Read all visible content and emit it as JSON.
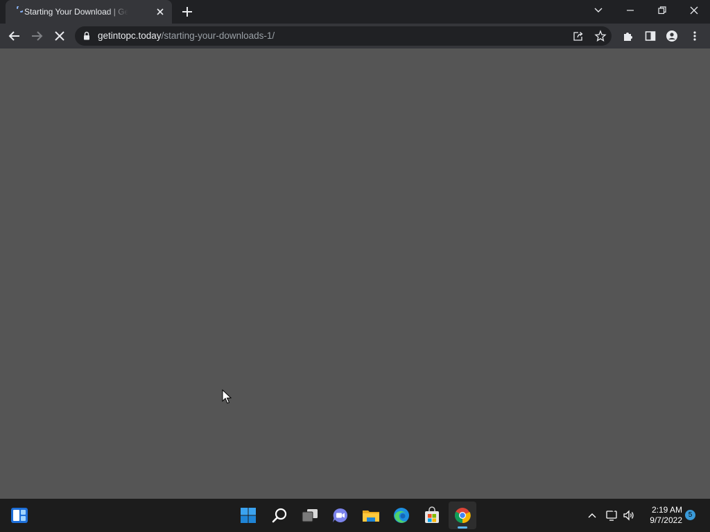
{
  "browser": {
    "tab": {
      "title": "Starting Your Download | Get Into PC",
      "close_icon": "close-icon",
      "loading_icon": "spinner-icon"
    },
    "new_tab_icon": "plus-icon",
    "window_controls": [
      "chevron-down-icon",
      "minimize-icon",
      "restore-icon",
      "close-icon"
    ],
    "address": {
      "host": "getintopc.today",
      "path": "/starting-your-downloads-1/"
    },
    "nav_icons": [
      "back-arrow-icon",
      "forward-arrow-icon",
      "stop-icon"
    ],
    "toolbar_icons": [
      "share-icon",
      "star-icon",
      "extensions-icon",
      "side-panel-icon",
      "profile-icon",
      "more-vert-icon"
    ],
    "colors": {
      "frame": "#202124",
      "toolbar": "#35363a",
      "content": "#555555"
    }
  },
  "taskbar": {
    "widgets_icon": "widgets-icon",
    "apps": [
      "windows-start-icon",
      "search-icon",
      "task-view-icon",
      "teams-chat-icon",
      "file-explorer-icon",
      "edge-icon",
      "store-icon",
      "chrome-icon"
    ],
    "tray": {
      "icons": [
        "chevron-up-icon",
        "network-icon",
        "volume-icon"
      ],
      "time": "2:19 AM",
      "date": "9/7/2022",
      "notification_count": "5"
    }
  }
}
